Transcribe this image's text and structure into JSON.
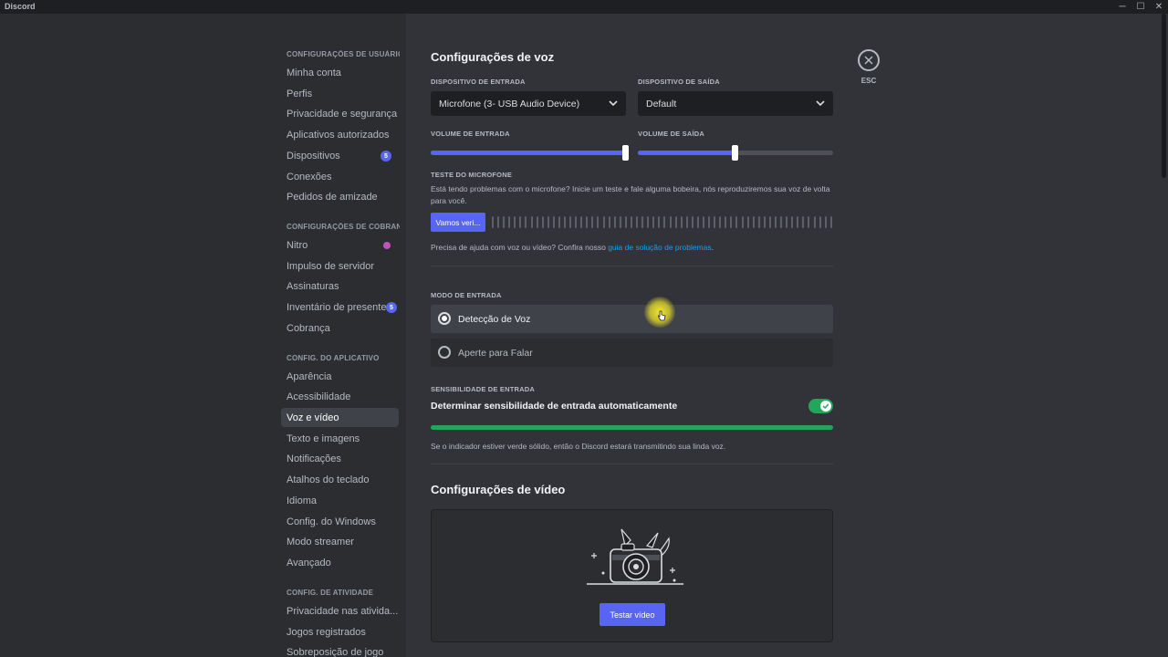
{
  "window": {
    "title": "Discord",
    "controls": [
      "─",
      "☐",
      "✕"
    ]
  },
  "sidebar": {
    "sections": [
      {
        "header": "CONFIGURAÇÕES DE USUÁRIO",
        "items": [
          {
            "label": "Minha conta"
          },
          {
            "label": "Perfis"
          },
          {
            "label": "Privacidade e segurança"
          },
          {
            "label": "Aplicativos autorizados"
          },
          {
            "label": "Dispositivos",
            "badge": "5"
          },
          {
            "label": "Conexões"
          },
          {
            "label": "Pedidos de amizade"
          }
        ]
      },
      {
        "header": "CONFIGURAÇÕES DE COBRANÇA",
        "items": [
          {
            "label": "Nitro"
          },
          {
            "label": "Impulso de servidor"
          },
          {
            "label": "Assinaturas"
          },
          {
            "label": "Inventário de presentes",
            "badge": "5"
          },
          {
            "label": "Cobrança"
          }
        ]
      },
      {
        "header": "CONFIG. DO APLICATIVO",
        "items": [
          {
            "label": "Aparência"
          },
          {
            "label": "Acessibilidade"
          },
          {
            "label": "Voz e vídeo",
            "active": true
          },
          {
            "label": "Texto e imagens"
          },
          {
            "label": "Notificações"
          },
          {
            "label": "Atalhos do teclado"
          },
          {
            "label": "Idioma"
          },
          {
            "label": "Config. do Windows"
          },
          {
            "label": "Modo streamer"
          },
          {
            "label": "Avançado"
          }
        ]
      },
      {
        "header": "CONFIG. DE ATIVIDADE",
        "items": [
          {
            "label": "Privacidade nas ativida..."
          },
          {
            "label": "Jogos registrados"
          },
          {
            "label": "Sobreposição de jogo"
          }
        ]
      }
    ]
  },
  "voice": {
    "title": "Configurações de voz",
    "input_device_label": "DISPOSITIVO DE ENTRADA",
    "input_device_value": "Microfone (3- USB Audio Device)",
    "output_device_label": "DISPOSITIVO DE SAÍDA",
    "output_device_value": "Default",
    "input_volume_label": "VOLUME DE ENTRADA",
    "input_volume_level": 1.0,
    "output_volume_label": "VOLUME DE SAÍDA",
    "output_volume_level": 0.5,
    "mic_test_label": "TESTE DO MICROFONE",
    "mic_test_desc": "Está tendo problemas com o microfone? Inicie um teste e fale alguma bobeira, nós reproduziremos sua voz de volta para você.",
    "mic_test_button": "Vamos veri...",
    "help_text": "Precisa de ajuda com voz ou vídeo? Confira nosso ",
    "help_link": "guia de solução de problemas",
    "help_end": ".",
    "input_mode_label": "MODO DE ENTRADA",
    "input_modes": [
      {
        "label": "Detecção de Voz",
        "selected": true
      },
      {
        "label": "Aperte para Falar",
        "selected": false
      }
    ],
    "sensitivity_label": "SENSIBILIDADE DE ENTRADA",
    "auto_sensitivity_label": "Determinar sensibilidade de entrada automaticamente",
    "auto_sensitivity_on": true,
    "sensitivity_note": "Se o indicador estiver verde sólido, então o Discord estará transmitindo sua linda voz."
  },
  "video": {
    "title": "Configurações de vídeo",
    "test_button": "Testar vídeo"
  },
  "close": {
    "label": "ESC"
  },
  "colors": {
    "accent": "#5865f2",
    "green": "#23a55a",
    "link": "#00a8fc",
    "bg": "#313338",
    "sidebar": "#2b2d31"
  }
}
